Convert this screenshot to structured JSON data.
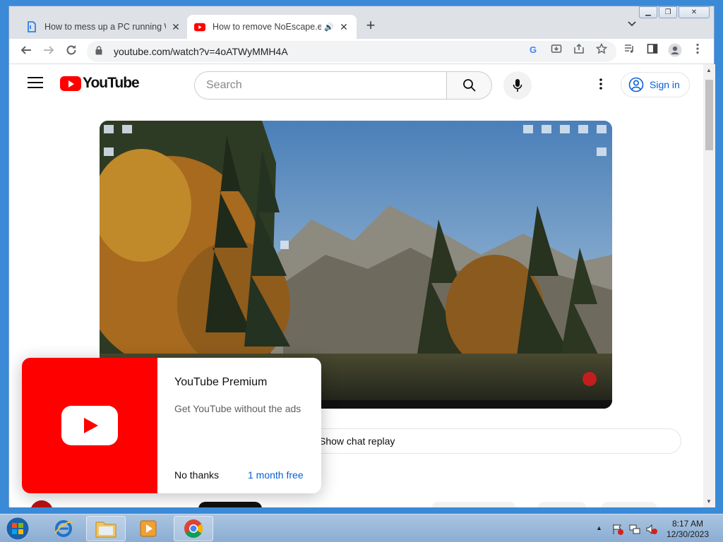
{
  "browser": {
    "tabs": [
      {
        "title": "How to mess up a PC running W",
        "active": false
      },
      {
        "title": "How to remove NoEscape.ex",
        "active": true
      }
    ],
    "new_tab_label": "+",
    "url": "youtube.com/watch?v=4oATWyMMH4A"
  },
  "youtube": {
    "logo_text": "YouTube",
    "search_placeholder": "Search",
    "sign_in_label": "Sign in",
    "show_chat_replay": "Show chat replay",
    "promo": {
      "title": "YouTube Premium",
      "subtitle": "Get YouTube without the ads",
      "dismiss_label": "No thanks",
      "cta_label": "1 month free"
    }
  },
  "taskbar": {
    "time": "8:17 AM",
    "date": "12/30/2023"
  },
  "colors": {
    "youtube_red": "#ff0000",
    "link_blue": "#065fd4",
    "chrome_frame": "#dee1e6"
  }
}
